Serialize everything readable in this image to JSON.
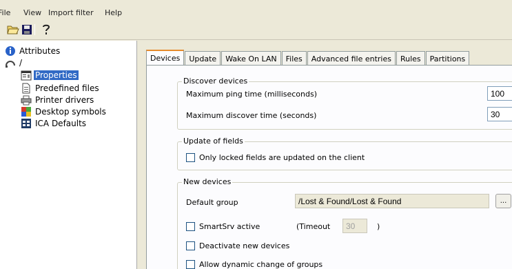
{
  "menu": {
    "file": "File",
    "view": "View",
    "import_filter": "Import filter",
    "help": "Help"
  },
  "toolbar": {
    "open_icon": "folder-open-icon",
    "save_icon": "floppy-disk-icon",
    "help_icon": "question-mark-icon"
  },
  "tree": {
    "attributes": "Attributes",
    "root": "/",
    "items": [
      {
        "label": "Properties",
        "icon": "properties-icon",
        "selected": true
      },
      {
        "label": "Predefined files",
        "icon": "document-icon"
      },
      {
        "label": "Printer drivers",
        "icon": "printer-icon"
      },
      {
        "label": "Desktop symbols",
        "icon": "desktop-symbols-icon"
      },
      {
        "label": "ICA Defaults",
        "icon": "ica-icon"
      }
    ]
  },
  "tabs": [
    {
      "label": "Devices",
      "active": true
    },
    {
      "label": "Update"
    },
    {
      "label": "Wake On LAN"
    },
    {
      "label": "Files"
    },
    {
      "label": "Advanced file entries"
    },
    {
      "label": "Rules"
    },
    {
      "label": "Partitions"
    }
  ],
  "discover": {
    "title": "Discover devices",
    "ping_label": "Maximum ping time (milliseconds)",
    "ping_value": "100",
    "discover_label": "Maximum discover time (seconds)",
    "discover_value": "30"
  },
  "update_fields": {
    "title": "Update of fields",
    "only_locked": "Only locked fields are updated on the client"
  },
  "new_devices": {
    "title": "New devices",
    "default_group_label": "Default group",
    "default_group_value": "/Lost & Found/Lost & Found",
    "browse": "...",
    "smartsrv": "SmartSrv active",
    "timeout_prefix": "(Timeout",
    "timeout_value": "30",
    "timeout_suffix": ")",
    "deactivate": "Deactivate new devices",
    "allow_dynamic": "Allow dynamic change of groups"
  }
}
